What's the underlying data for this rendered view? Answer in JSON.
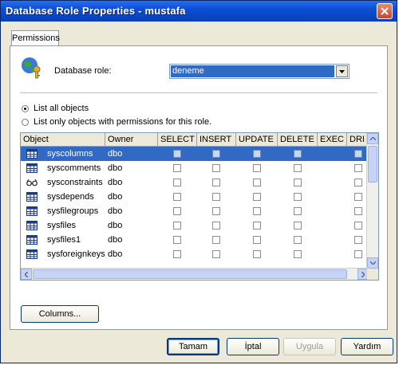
{
  "window": {
    "title": "Database Role Properties - mustafa"
  },
  "tabs": [
    {
      "label": "Permissions"
    }
  ],
  "role": {
    "label": "Database role:",
    "selected": "deneme"
  },
  "filter": {
    "options": [
      {
        "label": "List all objects",
        "checked": true
      },
      {
        "label": "List only objects with permissions for this role.",
        "checked": false
      }
    ]
  },
  "grid": {
    "columns": [
      "Object",
      "Owner",
      "SELECT",
      "INSERT",
      "UPDATE",
      "DELETE",
      "EXEC",
      "DRI"
    ],
    "rows": [
      {
        "object": "syscolumns",
        "owner": "dbo",
        "icon": "table-icon",
        "selected": true
      },
      {
        "object": "syscomments",
        "owner": "dbo",
        "icon": "table-icon",
        "selected": false
      },
      {
        "object": "sysconstraints",
        "owner": "dbo",
        "icon": "view-icon",
        "selected": false
      },
      {
        "object": "sysdepends",
        "owner": "dbo",
        "icon": "table-icon",
        "selected": false
      },
      {
        "object": "sysfilegroups",
        "owner": "dbo",
        "icon": "table-icon",
        "selected": false
      },
      {
        "object": "sysfiles",
        "owner": "dbo",
        "icon": "table-icon",
        "selected": false
      },
      {
        "object": "sysfiles1",
        "owner": "dbo",
        "icon": "table-icon",
        "selected": false
      },
      {
        "object": "sysforeignkeys",
        "owner": "dbo",
        "icon": "table-icon",
        "selected": false
      }
    ]
  },
  "buttons": {
    "columns": "Columns...",
    "ok": "Tamam",
    "cancel": "İptal",
    "apply": "Uygula",
    "help": "Yardım"
  },
  "colors": {
    "title_bar": "#0a4fd4",
    "selection": "#316ac5",
    "face": "#ece9d8"
  }
}
